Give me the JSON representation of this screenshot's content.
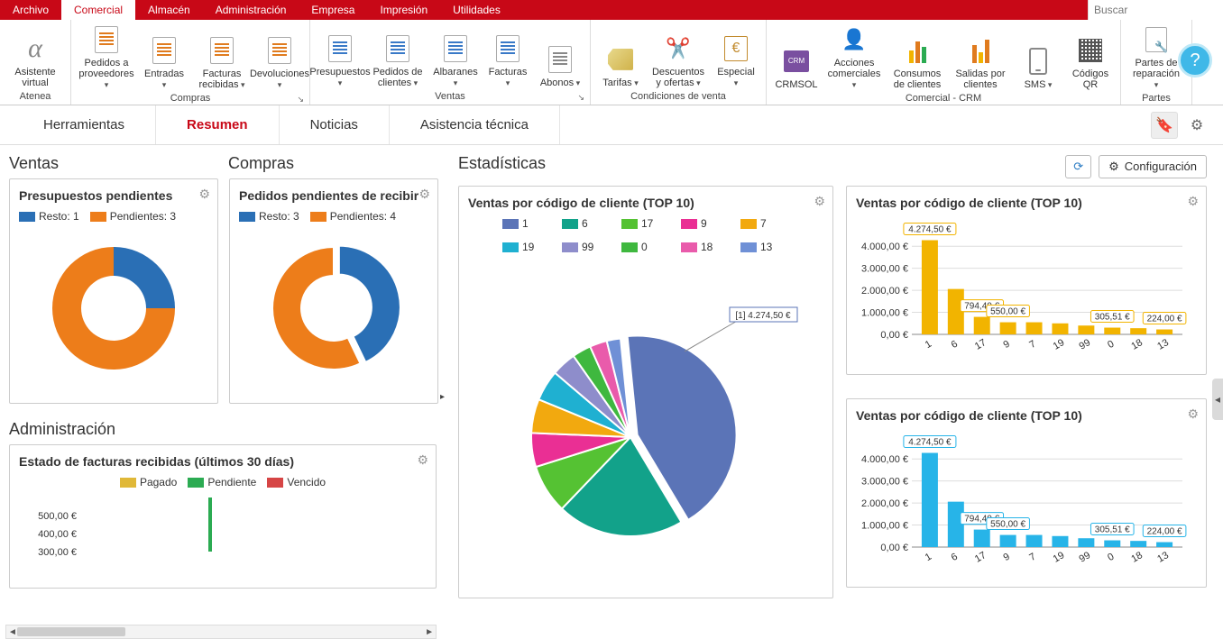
{
  "menubar": [
    "Archivo",
    "Comercial",
    "Almacén",
    "Administración",
    "Empresa",
    "Impresión",
    "Utilidades"
  ],
  "menubar_active": 1,
  "search_placeholder": "Buscar",
  "ribbon_groups": [
    {
      "label": "Atenea",
      "items": [
        {
          "key": "asistente",
          "label": "Asistente virtual"
        }
      ]
    },
    {
      "label": "Compras",
      "launcher": true,
      "items": [
        {
          "key": "ped-prov",
          "label": "Pedidos a proveedores",
          "caret": true
        },
        {
          "key": "entradas",
          "label": "Entradas",
          "caret": true
        },
        {
          "key": "fact-rec",
          "label": "Facturas recibidas",
          "caret": true
        },
        {
          "key": "devol",
          "label": "Devoluciones",
          "caret": true
        }
      ]
    },
    {
      "label": "Ventas",
      "launcher": true,
      "items": [
        {
          "key": "presup",
          "label": "Presupuestos",
          "caret": true
        },
        {
          "key": "ped-cli",
          "label": "Pedidos de clientes",
          "caret": true
        },
        {
          "key": "albaranes",
          "label": "Albaranes",
          "caret": true
        },
        {
          "key": "facturas",
          "label": "Facturas",
          "caret": true
        },
        {
          "key": "abonos",
          "label": "Abonos",
          "caret": true
        }
      ]
    },
    {
      "label": "Condiciones de venta",
      "items": [
        {
          "key": "tarifas",
          "label": "Tarifas",
          "caret": true
        },
        {
          "key": "desc",
          "label": "Descuentos y ofertas",
          "caret": true
        },
        {
          "key": "especial",
          "label": "Especial",
          "caret": true
        }
      ]
    },
    {
      "label": "Comercial - CRM",
      "items": [
        {
          "key": "crmsol",
          "label": "CRMSOL"
        },
        {
          "key": "acc-com",
          "label": "Acciones comerciales",
          "caret": true
        },
        {
          "key": "cons-cli",
          "label": "Consumos de clientes"
        },
        {
          "key": "sal-cli",
          "label": "Salidas por clientes"
        },
        {
          "key": "sms",
          "label": "SMS",
          "caret": true
        },
        {
          "key": "qr",
          "label": "Códigos QR"
        }
      ]
    },
    {
      "label": "Partes",
      "items": [
        {
          "key": "partes",
          "label": "Partes de reparación",
          "caret": true
        }
      ]
    }
  ],
  "subtabs": [
    "Herramientas",
    "Resumen",
    "Noticias",
    "Asistencia técnica"
  ],
  "subtabs_active": 1,
  "left": {
    "ventas_title": "Ventas",
    "compras_title": "Compras",
    "admin_title": "Administración",
    "card1_title": "Presupuestos pendientes",
    "card2_title": "Pedidos pendientes de recibir",
    "card3_title": "Estado de facturas recibidas (últimos 30 días)",
    "legend_labels": {
      "resto": "Resto:",
      "pendientes": "Pendientes:",
      "pagado": "Pagado",
      "pendiente": "Pendiente",
      "vencido": "Vencido"
    }
  },
  "right": {
    "stats_title": "Estadísticas",
    "refresh": "",
    "config_label": "Configuración",
    "pie_title": "Ventas por código de cliente (TOP 10)",
    "bar1_title": "Ventas por código de cliente (TOP 10)",
    "bar2_title": "Ventas por código de cliente (TOP 10)",
    "pie_callout": "[1] 4.274,50 €"
  },
  "chart_data": [
    {
      "id": "donut-presupuestos",
      "type": "pie",
      "title": "Presupuestos pendientes",
      "series": [
        {
          "name": "Resto",
          "value": 1,
          "color": "#2a6fb5"
        },
        {
          "name": "Pendientes",
          "value": 3,
          "color": "#ed7d1a"
        }
      ]
    },
    {
      "id": "donut-pedidos",
      "type": "pie",
      "title": "Pedidos pendientes de recibir",
      "series": [
        {
          "name": "Resto",
          "value": 3,
          "color": "#2a6fb5"
        },
        {
          "name": "Pendientes",
          "value": 4,
          "color": "#ed7d1a"
        }
      ]
    },
    {
      "id": "facturas-recibidas",
      "type": "bar",
      "title": "Estado de facturas recibidas (últimos 30 días)",
      "legend": [
        "Pagado",
        "Pendiente",
        "Vencido"
      ],
      "legend_colors": [
        "#e0b838",
        "#2bab52",
        "#d64545"
      ],
      "yticks": [
        300,
        400,
        500
      ],
      "ylabel_suffix": ",00 €"
    },
    {
      "id": "pie-top10",
      "type": "pie",
      "title": "Ventas por código de cliente (TOP 10)",
      "categories": [
        "1",
        "6",
        "17",
        "9",
        "7",
        "19",
        "99",
        "0",
        "18",
        "13"
      ],
      "values": [
        4274.5,
        2060,
        794.4,
        550.0,
        550.0,
        500.0,
        400.0,
        305.51,
        280.0,
        224.0
      ],
      "colors": [
        "#5b74b7",
        "#12a28a",
        "#55c233",
        "#ea2f94",
        "#f2a90f",
        "#1fb0d1",
        "#8e8dcb",
        "#3fb83f",
        "#e95bab",
        "#6f90d6"
      ],
      "callout": "[1] 4.274,50 €"
    },
    {
      "id": "bars-top10-a",
      "type": "bar",
      "title": "Ventas por código de cliente (TOP 10)",
      "categories": [
        "1",
        "6",
        "17",
        "9",
        "7",
        "19",
        "99",
        "0",
        "18",
        "13"
      ],
      "values": [
        4274.5,
        2060,
        794.4,
        550.0,
        550.0,
        500.0,
        400.0,
        305.51,
        280.0,
        224.0
      ],
      "value_labels": [
        "4.274,50 €",
        "",
        "794,40 €",
        "550,00 €",
        "",
        "",
        "",
        "305,51 €",
        "",
        "224,00 €"
      ],
      "ylim": [
        0,
        4500
      ],
      "yticks": [
        0,
        1000,
        2000,
        3000,
        4000
      ],
      "ytick_labels": [
        "0,00 €",
        "1.000,00 €",
        "2.000,00 €",
        "3.000,00 €",
        "4.000,00 €"
      ],
      "color": "#f2b400"
    },
    {
      "id": "bars-top10-b",
      "type": "bar",
      "title": "Ventas por código de cliente (TOP 10)",
      "categories": [
        "1",
        "6",
        "17",
        "9",
        "7",
        "19",
        "99",
        "0",
        "18",
        "13"
      ],
      "values": [
        4274.5,
        2060,
        794.4,
        550.0,
        550.0,
        500.0,
        400.0,
        305.51,
        280.0,
        224.0
      ],
      "value_labels": [
        "4.274,50 €",
        "",
        "794,40 €",
        "550,00 €",
        "",
        "",
        "",
        "305,51 €",
        "",
        "224,00 €"
      ],
      "ylim": [
        0,
        4500
      ],
      "yticks": [
        0,
        1000,
        2000,
        3000,
        4000
      ],
      "ytick_labels": [
        "0,00 €",
        "1.000,00 €",
        "2.000,00 €",
        "3.000,00 €",
        "4.000,00 €"
      ],
      "color": "#27b4e8"
    }
  ]
}
